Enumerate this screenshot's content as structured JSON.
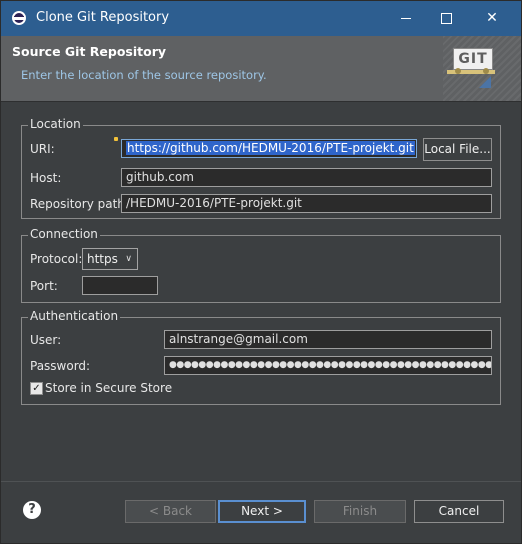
{
  "window": {
    "title": "Clone Git Repository",
    "minimize_glyph": "–",
    "maximize_glyph": "□",
    "close_glyph": "✕"
  },
  "header": {
    "title": "Source Git Repository",
    "subtitle": "Enter the location of the source repository.",
    "logo_text": "GIT"
  },
  "location": {
    "legend": "Location",
    "uri_label": "URI:",
    "uri_value": "https://github.com/HEDMU-2016/PTE-projekt.git",
    "local_file_button": "Local File...",
    "host_label": "Host:",
    "host_value": "github.com",
    "repo_path_label": "Repository path:",
    "repo_path_value": "/HEDMU-2016/PTE-projekt.git"
  },
  "connection": {
    "legend": "Connection",
    "protocol_label": "Protocol:",
    "protocol_value": "https",
    "port_label": "Port:",
    "port_value": ""
  },
  "authentication": {
    "legend": "Authentication",
    "user_label": "User:",
    "user_value": "alnstrange@gmail.com",
    "password_label": "Password:",
    "password_value": "●●●●●●●●●●●●●●●●●●●●●●●●●●●●●●●●●●●●●●●●●●●●●●",
    "store_label": "Store in Secure Store",
    "store_checked": true
  },
  "footer": {
    "help_glyph": "?",
    "back_button": "< Back",
    "next_button": "Next >",
    "finish_button": "Finish",
    "cancel_button": "Cancel"
  },
  "colors": {
    "titlebar": "#2d5e90",
    "background": "#3c3f41",
    "selection": "#2f65ca",
    "subtitle": "#9ec6e6"
  }
}
